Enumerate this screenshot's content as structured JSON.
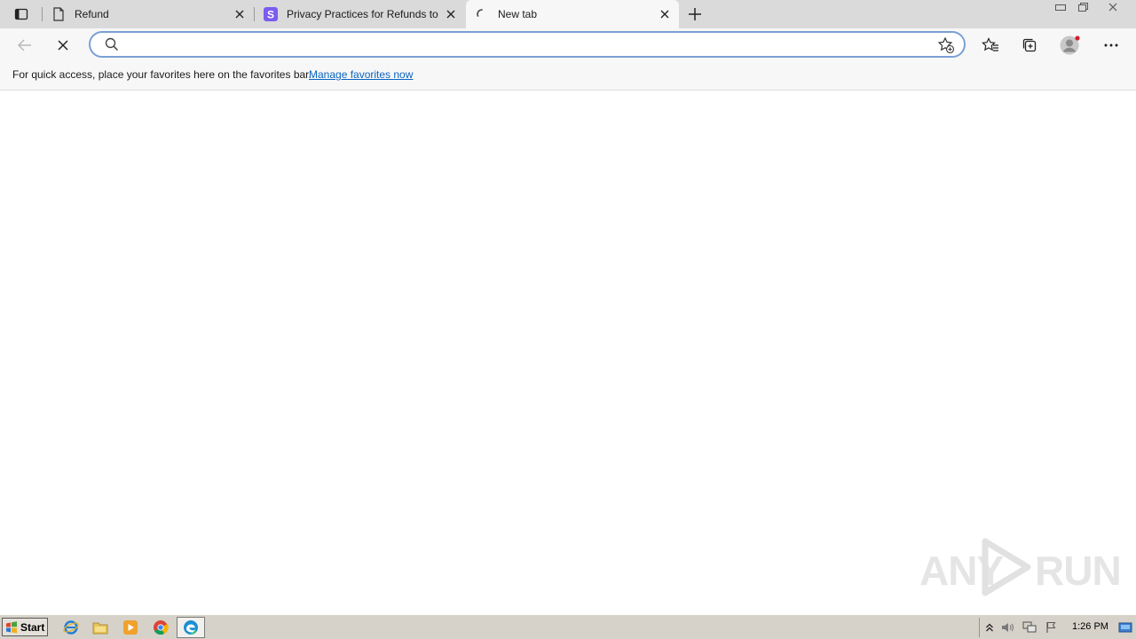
{
  "tabs": [
    {
      "title": "Refund",
      "favicon": "document-icon",
      "active": false
    },
    {
      "title": "Privacy Practices for Refunds to E",
      "favicon": "s-logo-icon",
      "active": false
    },
    {
      "title": "New tab",
      "favicon": "loading-spinner-icon",
      "active": true
    }
  ],
  "address_bar": {
    "value": "",
    "placeholder": ""
  },
  "favorites_bar": {
    "message": "For quick access, place your favorites here on the favorites bar.",
    "link": "Manage favorites now"
  },
  "watermark": {
    "left": "ANY",
    "right": "RUN"
  },
  "taskbar": {
    "start_label": "Start",
    "pinned": [
      "internet-explorer-icon",
      "file-explorer-icon",
      "media-player-icon",
      "chrome-icon",
      "edge-icon"
    ],
    "clock": "1:26 PM"
  },
  "colors": {
    "accent": "#0a64c2",
    "address_border": "#7ba0d6",
    "tabstrip": "#dadada",
    "toolbar": "#f7f7f7",
    "taskbar": "#d6d2c9"
  }
}
